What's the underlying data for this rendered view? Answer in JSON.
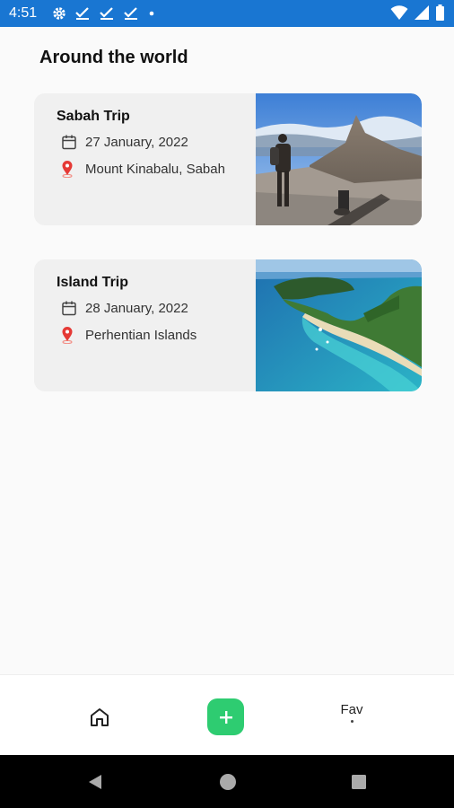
{
  "status_bar": {
    "time": "4:51",
    "left_icons": [
      "gear-icon",
      "check-icon",
      "check-icon",
      "check-icon",
      "dot-icon"
    ],
    "right_icons": [
      "wifi-icon",
      "signal-icon",
      "battery-icon"
    ]
  },
  "page": {
    "title": "Around the world"
  },
  "trips": [
    {
      "title": "Sabah Trip",
      "date": "27 January, 2022",
      "location": "Mount Kinabalu, Sabah",
      "image": "mountain-hiker-photo"
    },
    {
      "title": "Island Trip",
      "date": "28 January, 2022",
      "location": "Perhentian Islands",
      "image": "tropical-island-photo"
    }
  ],
  "bottom_nav": {
    "home_icon": "home-icon",
    "add_icon": "plus-icon",
    "fav_label": "Fav"
  },
  "colors": {
    "status_bar": "#1976d2",
    "add_button": "#2ecc71",
    "pin": "#e53935",
    "card_bg": "#f0f0f0"
  }
}
